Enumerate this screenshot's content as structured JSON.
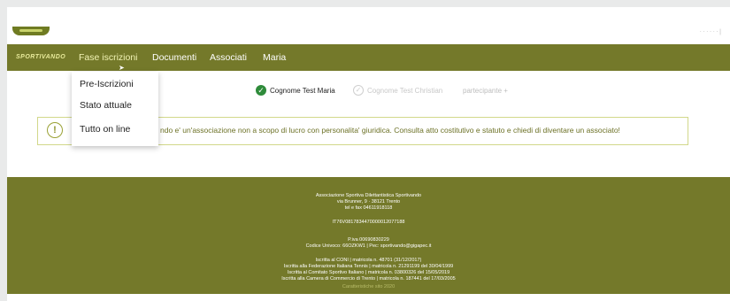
{
  "header": {
    "top_right_text": "ᐧ ᐧ ᐧ ᐧ ᐧ ᐧ |"
  },
  "nav": {
    "brand": "SPORTIVANDO",
    "items": [
      {
        "label": "Fase iscrizioni"
      },
      {
        "label": "Documenti"
      },
      {
        "label": "Associati"
      },
      {
        "label": "Maria"
      }
    ]
  },
  "dropdown": {
    "items": [
      {
        "label": "Pre-Iscrizioni"
      },
      {
        "label": "Stato attuale"
      },
      {
        "label": "Tutto on line"
      }
    ]
  },
  "participants": {
    "active": {
      "label": "Cognome Test  Maria"
    },
    "inactive": {
      "label": "Cognome Test  Christian"
    },
    "add": {
      "label": "partecipante +"
    }
  },
  "alert": {
    "icon_text": "!",
    "text": "ndo e' un'associazione non a scopo di lucro con personalita' giuridica. Consulta atto costitutivo e statuto e chiedi di diventare un associato!"
  },
  "footer": {
    "lines": [
      "Associazione Sportiva Dilettantistica Sportivando",
      "via Brunner, 9 · 38121 Trento",
      "tel e fax 04611918118",
      "IT76V0817834470000012077188",
      "P.iva 00690830229",
      "Codice Univoco: 66OZKW1 | Pec: sportivando@gigapec.it",
      "Iscritta al CONI | matricola n. 48701 (31/12/2017)",
      "Iscritta alla Federazione Italiana Tennis | matricola n. 21291199 del 30/04/1999",
      "Iscritta al Comitato Sportivo Italiano | matricola n. 03800326 del 15/05/2019",
      "Iscritta alla Camera di Commercio di Trento | matricola n. 187441 del 17/03/2005",
      "Caratteristiche sito 2020"
    ]
  },
  "colors": {
    "nav_bg": "#74792a",
    "footer_bg": "#74792a",
    "alert_border": "#d2d88a",
    "alert_text": "#6c7126",
    "active_check": "#2e8b3a"
  }
}
